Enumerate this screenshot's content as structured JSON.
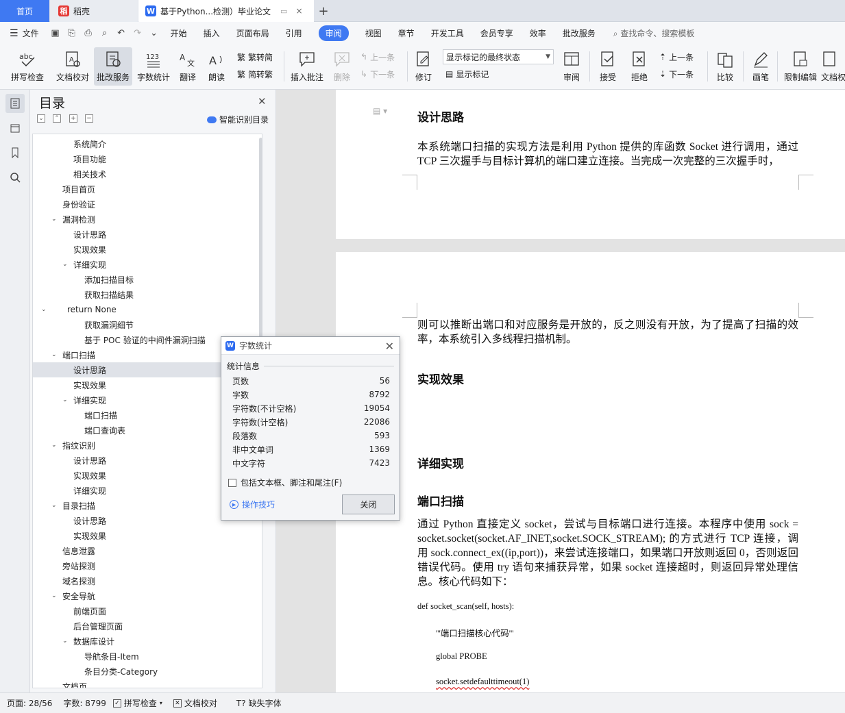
{
  "tabs": {
    "home": "首页",
    "daoke": "稻壳",
    "doc": "基于Python...检测）毕业论文"
  },
  "menubar": {
    "file": "文件",
    "items": [
      "开始",
      "插入",
      "页面布局",
      "引用",
      "审阅",
      "视图",
      "章节",
      "开发工具",
      "会员专享",
      "效率",
      "批改服务"
    ],
    "active": "审阅",
    "search_placeholder": "查找命令、搜索模板"
  },
  "ribbon": {
    "spell": "拼写检查",
    "proof": "文档校对",
    "review_service": "批改服务",
    "wordcount": "字数统计",
    "translate": "翻译",
    "read": "朗读",
    "to_trad": "繁转简",
    "to_simp": "简转繁",
    "insert_comment": "插入批注",
    "delete": "删除",
    "prev": "上一条",
    "next": "下一条",
    "track": "修订",
    "markup_state": "显示标记的最终状态",
    "show_markup": "显示标记",
    "review": "审阅",
    "accept": "接受",
    "reject": "拒绝",
    "prev2": "上一条",
    "next2": "下一条",
    "compare": "比较",
    "pen": "画笔",
    "restrict": "限制编辑",
    "doc_perm": "文档权"
  },
  "toc": {
    "title": "目录",
    "smart": "智能识别目录",
    "items": [
      {
        "text": "系统简介",
        "level": 2
      },
      {
        "text": "项目功能",
        "level": 2
      },
      {
        "text": "相关技术",
        "level": 2
      },
      {
        "text": "项目首页",
        "level": 1
      },
      {
        "text": "身份验证",
        "level": 1
      },
      {
        "text": "漏洞检测",
        "level": 1,
        "expanded": true
      },
      {
        "text": "设计思路",
        "level": 2
      },
      {
        "text": "实现效果",
        "level": 2
      },
      {
        "text": "详细实现",
        "level": 2,
        "expanded": true
      },
      {
        "text": "添加扫描目标",
        "level": 3
      },
      {
        "text": "获取扫描结果",
        "level": 3
      },
      {
        "text": "return None",
        "level": 0,
        "expanded": true
      },
      {
        "text": "获取漏洞细节",
        "level": 3
      },
      {
        "text": "基于 POC 验证的中间件漏洞扫描",
        "level": 3
      },
      {
        "text": "端口扫描",
        "level": 1,
        "expanded": true
      },
      {
        "text": "设计思路",
        "level": 2,
        "selected": true
      },
      {
        "text": "实现效果",
        "level": 2
      },
      {
        "text": "详细实现",
        "level": 2,
        "expanded": true
      },
      {
        "text": "端口扫描",
        "level": 3
      },
      {
        "text": "端口查询表",
        "level": 3
      },
      {
        "text": "指纹识别",
        "level": 1,
        "expanded": true
      },
      {
        "text": "设计思路",
        "level": 2
      },
      {
        "text": "实现效果",
        "level": 2
      },
      {
        "text": "详细实现",
        "level": 2
      },
      {
        "text": "目录扫描",
        "level": 1,
        "expanded": true
      },
      {
        "text": "设计思路",
        "level": 2
      },
      {
        "text": "实现效果",
        "level": 2
      },
      {
        "text": "信息泄露",
        "level": 1
      },
      {
        "text": "旁站探测",
        "level": 1
      },
      {
        "text": "域名探测",
        "level": 1
      },
      {
        "text": "安全导航",
        "level": 1,
        "expanded": true
      },
      {
        "text": "前端页面",
        "level": 2
      },
      {
        "text": "后台管理页面",
        "level": 2
      },
      {
        "text": "数据库设计",
        "level": 2,
        "expanded": true
      },
      {
        "text": "导航条目-Item",
        "level": 3
      },
      {
        "text": "条目分类-Category",
        "level": 3
      },
      {
        "text": "文档页",
        "level": 1
      }
    ]
  },
  "document": {
    "h_design": "设计思路",
    "p1": "本系统端口扫描的实现方法是利用 Python 提供的库函数 Socket 进行调用，通过 TCP 三次握手与目标计算机的端口建立连接。当完成一次完整的三次握手时，",
    "p2": "则可以推断出端口和对应服务是开放的，反之则没有开放，为了提高了扫描的效率，本系统引入多线程扫描机制。",
    "h_effect": "实现效果",
    "h_detail": "详细实现",
    "h_port": "端口扫描",
    "p3": "通过 Python 直接定义 socket，尝试与目标端口进行连接。本程序中使用 sock = socket.socket(socket.AF_INET,socket.SOCK_STREAM); 的方式进行 TCP 连接，调用 sock.connect_ex((ip,port))，来尝试连接端口，如果端口开放则返回 0，否则返回错误代码。使用 try 语句来捕获异常，如果 socket 连接超时，则返回异常处理信息。核心代码如下：",
    "code1": "def socket_scan(self, hosts):",
    "code2": "'''端口扫描核心代码'''",
    "code3": "global PROBE",
    "code4": "socket.setdefaulttimeout(1)"
  },
  "dialog": {
    "title": "字数统计",
    "group": "统计信息",
    "stats": [
      {
        "label": "页数",
        "value": "56"
      },
      {
        "label": "字数",
        "value": "8792"
      },
      {
        "label": "字符数(不计空格)",
        "value": "19054"
      },
      {
        "label": "字符数(计空格)",
        "value": "22086"
      },
      {
        "label": "段落数",
        "value": "593"
      },
      {
        "label": "非中文单词",
        "value": "1369"
      },
      {
        "label": "中文字符",
        "value": "7423"
      }
    ],
    "include": "包括文本框、脚注和尾注(F)",
    "tips": "操作技巧",
    "close": "关闭"
  },
  "status": {
    "page": "页面: 28/56",
    "words": "字数: 8799",
    "spell": "拼写检查",
    "proof": "文档校对",
    "missing_font": "缺失字体"
  },
  "colors": {
    "accent": "#3f79f2"
  }
}
